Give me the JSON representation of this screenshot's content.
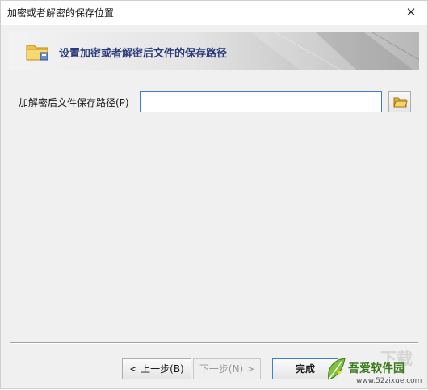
{
  "window": {
    "title": "加密或者解密的保存位置",
    "close_glyph": "✕"
  },
  "banner": {
    "text": "设置加密或者解密后文件的保存路径",
    "icon": "folder-icon"
  },
  "form": {
    "path_label": "加解密后文件保存路径(P)",
    "path_value": "",
    "browse_icon": "folder-open-icon"
  },
  "buttons": {
    "prev": "< 上一步(B)",
    "next": "下一步(N) >",
    "finish": "完成"
  },
  "watermark": {
    "faded": "下载",
    "brand": "吾爱软件园",
    "url": "www.52zixue.com"
  },
  "colors": {
    "accent": "#3c7fd1",
    "banner_text": "#2a3a7a",
    "watermark_green": "#3c7a1e"
  }
}
